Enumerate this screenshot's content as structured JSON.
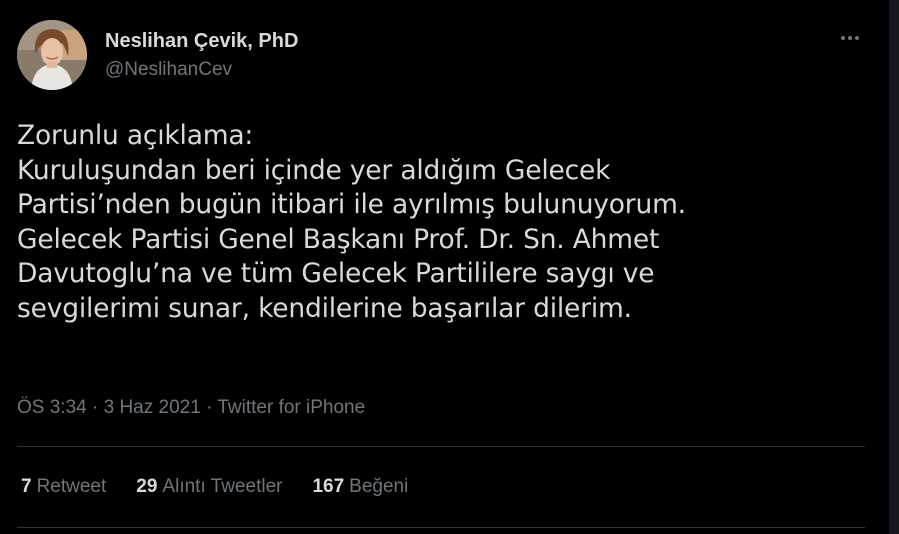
{
  "author": {
    "display_name": "Neslihan Çevik, PhD",
    "handle": "@NeslihanCev",
    "avatar_icon": "profile-photo"
  },
  "more_icon": "more-horizontal-icon",
  "tweet": {
    "lines": [
      "Zorunlu açıklama:",
      "Kuruluşundan beri içinde yer aldığım Gelecek",
      "Partisi’nden bugün itibari ile  ayrılmış bulunuyorum.",
      "Gelecek Partisi Genel Başkanı Prof. Dr. Sn. Ahmet",
      "Davutoglu’na ve tüm Gelecek Partililere saygı ve",
      "sevgilerimi sunar, kendilerine başarılar dilerim."
    ]
  },
  "meta": {
    "time": "ÖS 3:34",
    "separator": " · ",
    "date": "3 Haz 2021",
    "source": "Twitter for iPhone"
  },
  "stats": {
    "retweets": {
      "count": "7",
      "label": "Retweet"
    },
    "quotes": {
      "count": "29",
      "label": "Alıntı Tweetler"
    },
    "likes": {
      "count": "167",
      "label": "Beğeni"
    }
  },
  "colors": {
    "background": "#000000",
    "text": "#d9d9d9",
    "muted": "#6e767d",
    "divider": "#2f3336"
  }
}
